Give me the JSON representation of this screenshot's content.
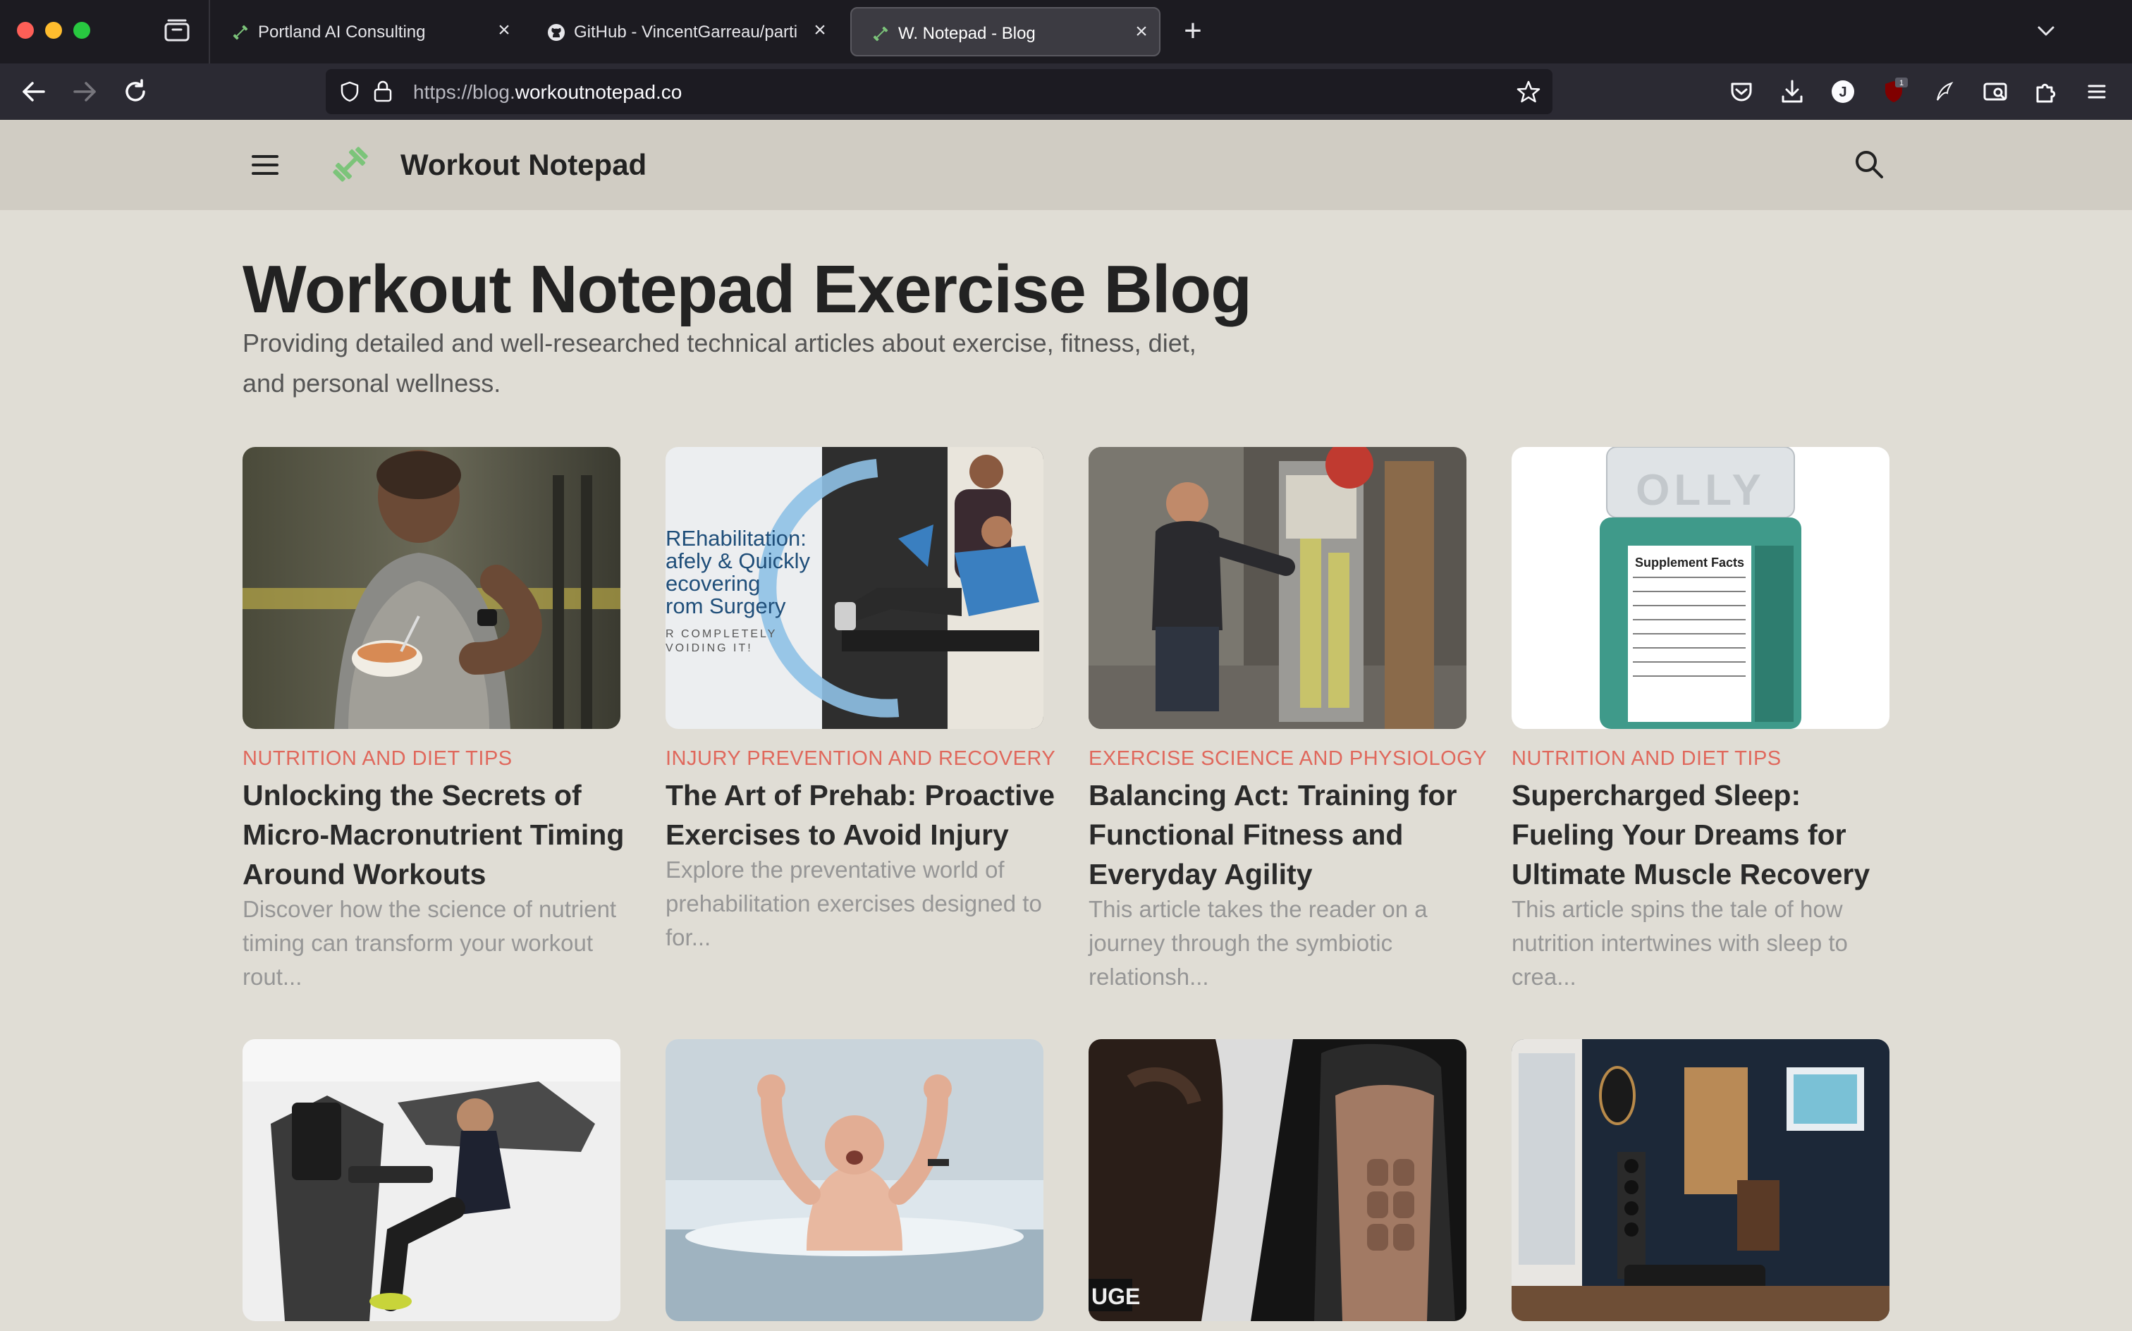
{
  "browser": {
    "tabs": [
      {
        "title": "Portland AI Consulting",
        "favicon": "dumbbell-icon",
        "active": false
      },
      {
        "title": "GitHub - VincentGarreau/particles",
        "favicon": "github-icon",
        "active": false
      },
      {
        "title": "W. Notepad - Blog",
        "favicon": "dumbbell-icon",
        "active": true
      }
    ],
    "url_prefix": "https://blog.",
    "url_host": "workoutnotepad.co",
    "toolbar_icons": [
      "pocket-icon",
      "download-icon",
      "profile-icon",
      "ublock-icon",
      "extension-icon",
      "screenshot-icon",
      "extensions-puzzle-icon",
      "menu-icon"
    ],
    "ublock_badge": "1",
    "profile_initial": "J"
  },
  "site": {
    "title": "Workout Notepad",
    "heading": "Workout Notepad Exercise Blog",
    "description": "Providing detailed and well-researched technical articles about exercise, fitness, diet, and personal wellness.",
    "accent": "#e0685c"
  },
  "posts": [
    {
      "category": "NUTRITION AND DIET TIPS",
      "title": "Unlocking the Secrets of Micro-Macronutrient Timing Around Workouts",
      "excerpt": "Discover how the science of nutrient timing can transform your workout rout..."
    },
    {
      "category": "INJURY PREVENTION AND RECOVERY",
      "title": "The Art of Prehab: Proactive Exercises to Avoid Injury",
      "excerpt": "Explore the preventative world of prehabilitation exercises designed to for...",
      "image_text": [
        "REhabilitation:",
        "afely & Quickly",
        "ecovering",
        "rom Surgery",
        "R COMPLETELY",
        "VOIDING IT!"
      ]
    },
    {
      "category": "EXERCISE SCIENCE AND PHYSIOLOGY",
      "title": "Balancing Act: Training for Functional Fitness and Everyday Agility",
      "excerpt": "This article takes the reader on a journey through the symbiotic relationsh..."
    },
    {
      "category": "NUTRITION AND DIET TIPS",
      "title": "Supercharged Sleep: Fueling Your Dreams for Ultimate Muscle Recovery",
      "excerpt": "This article spins the tale of how nutrition intertwines with sleep to crea...",
      "image_text": [
        "OLLY",
        "Supplement Facts"
      ]
    }
  ],
  "posts_row2_image_text": [
    "UGE"
  ]
}
